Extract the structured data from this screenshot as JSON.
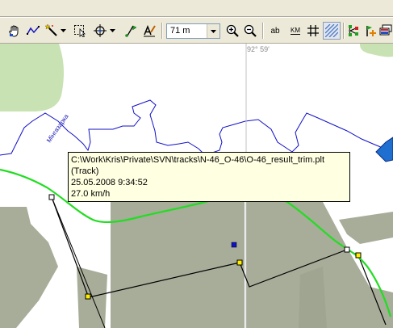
{
  "toolbar": {
    "scale_value": "71 m",
    "text_button_ab": "ab",
    "text_button_km": "KM",
    "buttons": [
      "hand-icon",
      "polyline-icon",
      "magic-wand-icon",
      "select-area-icon",
      "compass-icon",
      "waypoint-flag-icon",
      "edit-text-icon",
      "zoom-in-icon",
      "zoom-out-icon",
      "grid-icon",
      "hatch-icon",
      "track-nodes-icon",
      "track-add-icon",
      "layers-icon"
    ]
  },
  "map": {
    "coordinate_label": "92° 59'",
    "river_label": "Мінгазарка",
    "colors": {
      "forest": "#c8e2b4",
      "urban": "#a7ad99",
      "river": "#1010c8",
      "track": "#22dd22",
      "road": "#000000"
    }
  },
  "tooltip": {
    "path": "C:\\Work\\Kris\\Private\\SVN\\tracks\\N-46_O-46\\O-46_result_trim.plt",
    "type": "(Track)",
    "datetime": "25.05.2008 9:34:52",
    "speed": "27.0 km/h"
  }
}
